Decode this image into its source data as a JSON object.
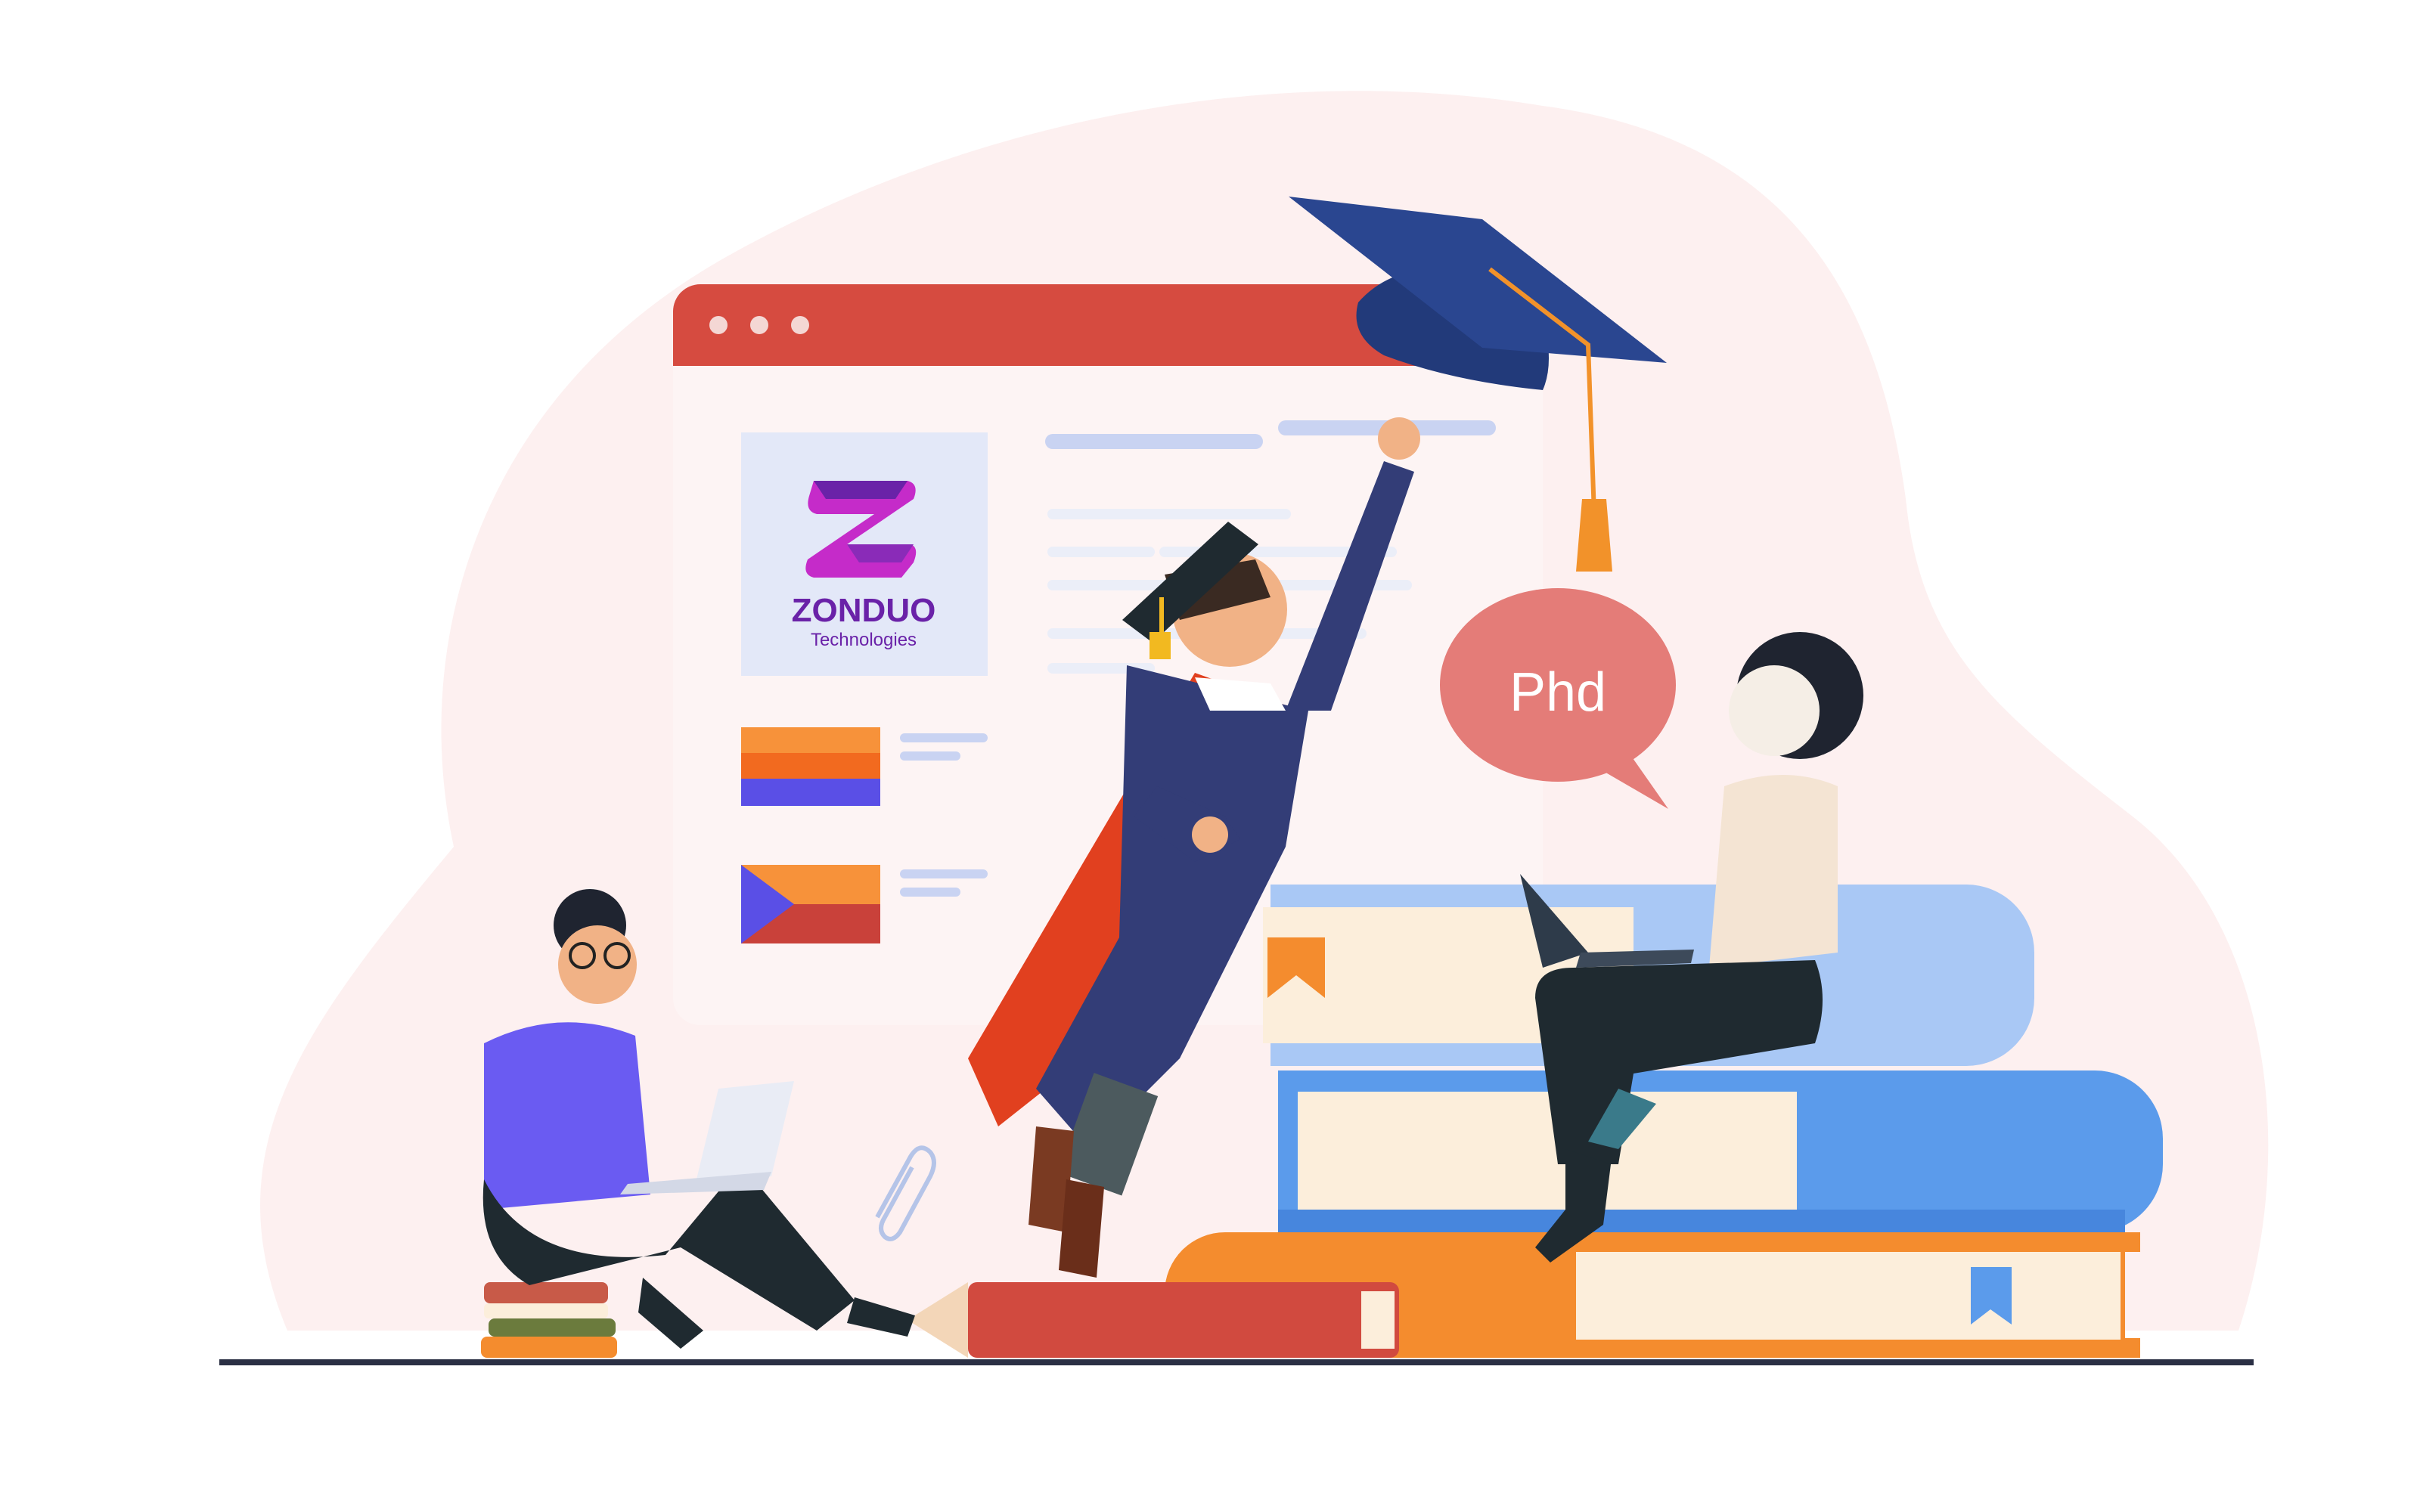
{
  "logo": {
    "name": "ZONDUO",
    "subtitle": "Technologies"
  },
  "speech_bubble": {
    "text": "Phd"
  },
  "colors": {
    "blob": "#FDF0F0",
    "window_bar": "#D64B40",
    "window_body": "#FDF4F4",
    "logo_panel": "#E3E8F8",
    "logo_purple": "#6A22A8",
    "logo_magenta": "#C52BC9",
    "placeholder_line": "#C9D3F2",
    "cap": "#2A4690",
    "tassel": "#F2922A",
    "bubble": "#E47C78",
    "ground": "#2A2F44",
    "book_blue_light": "#A9C8F5",
    "book_blue": "#5B9BEB",
    "book_orange": "#F48C2E",
    "book_red": "#D14A3F",
    "page_cream": "#FCEEDB"
  },
  "icons": [
    "browser-window-dots-icon",
    "graduation-cap-icon",
    "paperclip-icon",
    "bookmark-icon",
    "laptop-icon",
    "flag-icon"
  ]
}
